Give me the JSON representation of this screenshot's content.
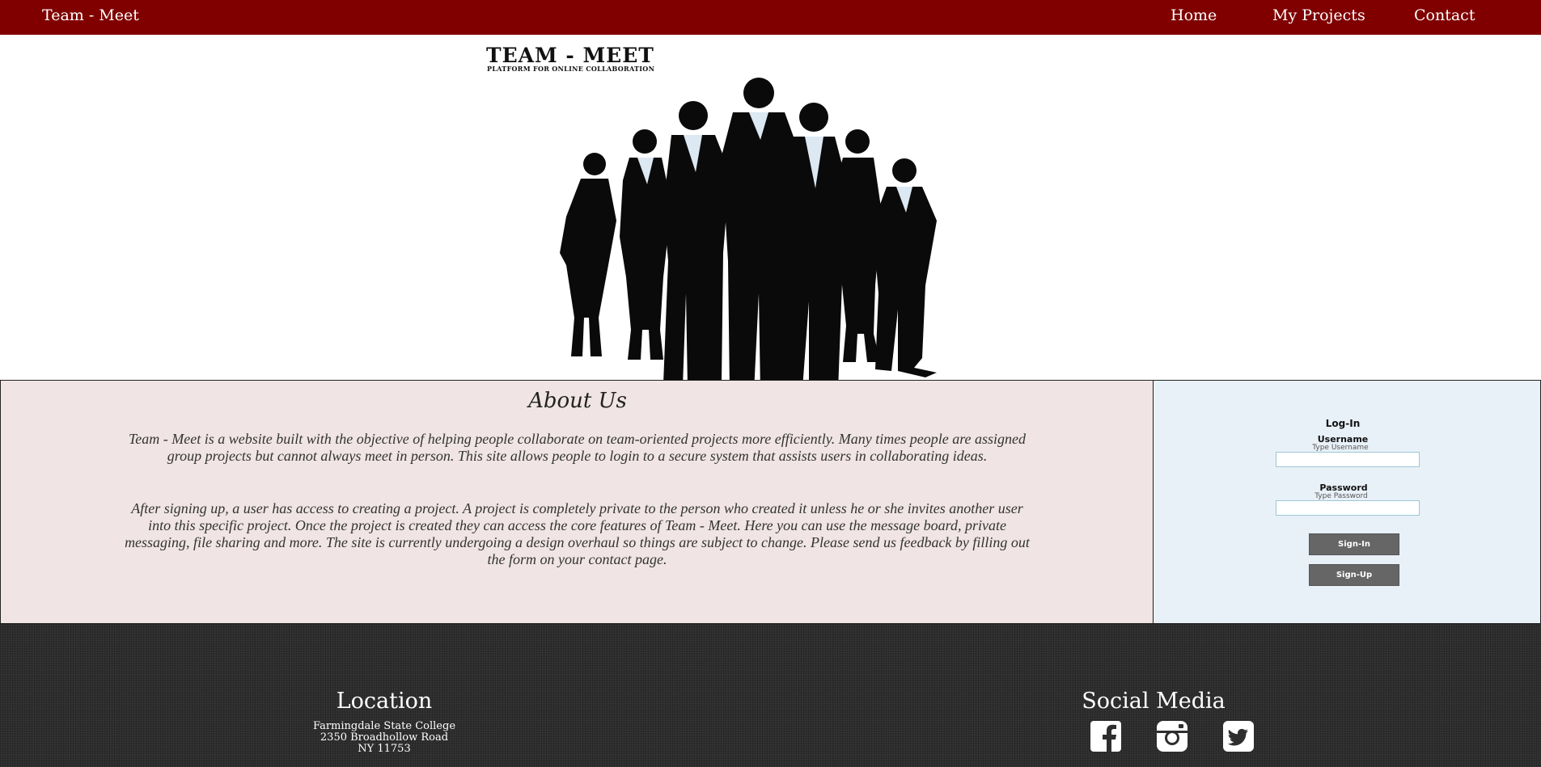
{
  "nav": {
    "brand": "Team - Meet",
    "links": [
      "Home",
      "My Projects",
      "Contact"
    ]
  },
  "hero": {
    "title": "TEAM - MEET",
    "subtitle": "PLATFORM FOR ONLINE COLLABORATION",
    "image": "business-team-silhouette"
  },
  "about": {
    "heading": "About Us",
    "paragraphs": [
      "Team - Meet is a website built with the objective of helping people collaborate on team-oriented projects more efficiently. Many times people are assigned group projects but cannot always meet in person. This site allows people to login to a secure system that assists users in collaborating ideas.",
      "After signing up, a user has access to creating a project. A project is completely private to the person who created it unless he or she invites another user into this specific project. Once the project is created they can access the core features of Team - Meet. Here you can use the message board, private messaging, file sharing and more. The site is currently undergoing a design overhaul so things are subject to change. Please send us feedback by filling out the form on your contact page."
    ]
  },
  "login": {
    "title": "Log-In",
    "username_label": "Username",
    "username_hint": "Type Username",
    "username_value": "",
    "password_label": "Password",
    "password_hint": "Type Password",
    "password_value": "",
    "signin_label": "Sign-In",
    "signup_label": "Sign-Up"
  },
  "footer": {
    "location_heading": "Location",
    "address": [
      "Farmingdale State College",
      "2350 Broadhollow Road",
      "NY 11753"
    ],
    "social_heading": "Social Media",
    "social_icons": [
      "facebook-icon",
      "instagram-icon",
      "twitter-icon"
    ]
  },
  "colors": {
    "nav_bg": "#800000",
    "about_bg": "#f0e4e4",
    "login_bg": "#e8f0f8",
    "button_bg": "#666666",
    "footer_bg": "#2e2e2e"
  }
}
